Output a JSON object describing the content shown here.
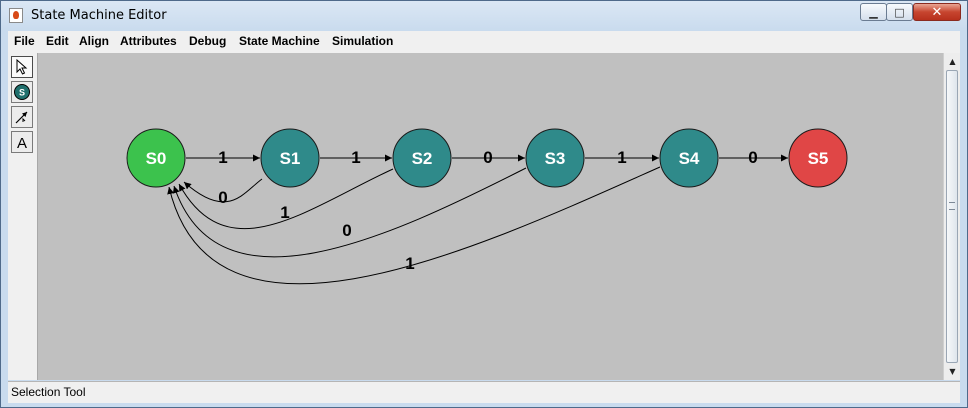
{
  "window": {
    "title": "State Machine Editor",
    "close_glyph": "✕",
    "minimize_glyph": "▁",
    "maximize_glyph": "□"
  },
  "menu": [
    "File",
    "Edit",
    "Align",
    "Attributes",
    "Debug",
    "State Machine",
    "Simulation"
  ],
  "tools": [
    {
      "name": "selection-tool-icon",
      "selected": true
    },
    {
      "name": "state-tool-icon",
      "selected": false
    },
    {
      "name": "transition-tool-icon",
      "selected": false
    },
    {
      "name": "text-tool-icon",
      "selected": false
    }
  ],
  "state_tool_glyph": "S",
  "text_tool_glyph": "A",
  "diagram": {
    "states": [
      {
        "id": "S0",
        "label": "S0",
        "color": "#3cc24d"
      },
      {
        "id": "S1",
        "label": "S1",
        "color": "#2f8a8a"
      },
      {
        "id": "S2",
        "label": "S2",
        "color": "#2f8a8a"
      },
      {
        "id": "S3",
        "label": "S3",
        "color": "#2f8a8a"
      },
      {
        "id": "S4",
        "label": "S4",
        "color": "#2f8a8a"
      },
      {
        "id": "S5",
        "label": "S5",
        "color": "#e04646"
      }
    ],
    "transitions": [
      {
        "from": "S0",
        "to": "S1",
        "label": "1"
      },
      {
        "from": "S1",
        "to": "S2",
        "label": "1"
      },
      {
        "from": "S2",
        "to": "S3",
        "label": "0"
      },
      {
        "from": "S3",
        "to": "S4",
        "label": "1"
      },
      {
        "from": "S4",
        "to": "S5",
        "label": "0"
      },
      {
        "from": "S1",
        "to": "S0",
        "label": "0"
      },
      {
        "from": "S2",
        "to": "S0",
        "label": "1"
      },
      {
        "from": "S3",
        "to": "S0",
        "label": "0"
      },
      {
        "from": "S4",
        "to": "S0",
        "label": "1"
      }
    ]
  },
  "status": "Selection Tool"
}
